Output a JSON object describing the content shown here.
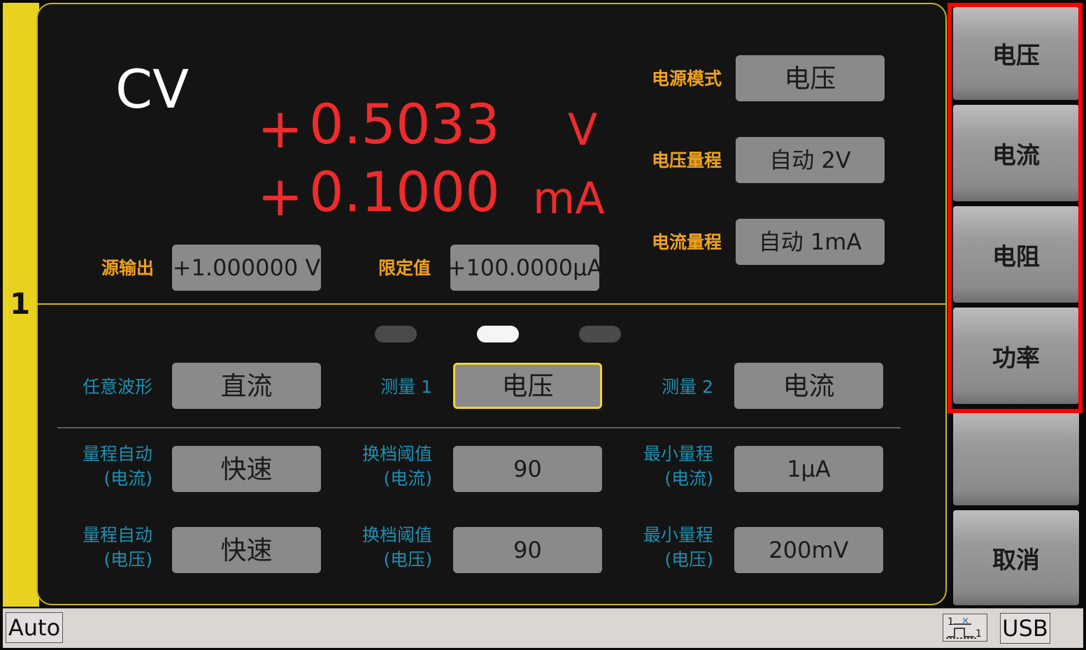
{
  "channel": {
    "number": "1"
  },
  "display": {
    "mode": "CV",
    "voltage": {
      "sign": "+",
      "value": "0.5033",
      "unit": "V"
    },
    "current": {
      "sign": "+",
      "value": "0.1000",
      "unit": "mA"
    }
  },
  "source": {
    "output_label": "源输出",
    "output_value": "+1.000000 V",
    "limit_label": "限定值",
    "limit_value": "+100.0000µA"
  },
  "settings": {
    "power_mode_label": "电源模式",
    "power_mode_value": "电压",
    "voltage_range_label": "电压量程",
    "voltage_range_value": "自动 2V",
    "current_range_label": "电流量程",
    "current_range_value": "自动 1mA"
  },
  "measure": {
    "waveform_label": "任意波形",
    "waveform_value": "直流",
    "measure1_label": "测量 1",
    "measure1_value": "电压",
    "measure2_label": "测量 2",
    "measure2_value": "电流"
  },
  "range_rows": [
    {
      "auto_label_1": "量程自动",
      "auto_label_2": "(电流)",
      "auto_value": "快速",
      "threshold_label_1": "换档阈值",
      "threshold_label_2": "(电流)",
      "threshold_value": "90",
      "min_label_1": "最小量程",
      "min_label_2": "(电流)",
      "min_value": "1µA"
    },
    {
      "auto_label_1": "量程自动",
      "auto_label_2": "(电压)",
      "auto_value": "快速",
      "threshold_label_1": "换档阈值",
      "threshold_label_2": "(电压)",
      "threshold_value": "90",
      "min_label_1": "最小量程",
      "min_label_2": "(电压)",
      "min_value": "200mV"
    }
  ],
  "softkeys": [
    "电压",
    "电流",
    "电阻",
    "功率",
    "",
    "取消"
  ],
  "status": {
    "auto": "Auto",
    "usb": "USB"
  },
  "colors": {
    "highlight": "#ff0000",
    "reading": "#ef2b2b",
    "label_orange": "#f0a21c",
    "label_blue": "#1f8fb0",
    "accent_yellow": "#e8d21f"
  }
}
